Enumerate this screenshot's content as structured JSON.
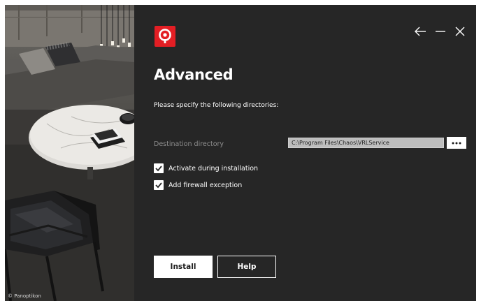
{
  "page": {
    "title": "Advanced",
    "subtitle": "Please specify the following directories:"
  },
  "photo": {
    "credit": "© Panoptikon"
  },
  "window_controls": {
    "back_icon": "arrow-left-icon",
    "minimize_icon": "minimize-icon",
    "close_icon": "close-icon"
  },
  "destination": {
    "label": "Destination directory",
    "value": "C:\\Program Files\\Chaos\\VRLService",
    "browse_icon": "ellipsis-icon"
  },
  "options": [
    {
      "label": "Activate during installation",
      "checked": true
    },
    {
      "label": "Add firewall exception",
      "checked": true
    }
  ],
  "buttons": {
    "install": "Install",
    "help": "Help"
  },
  "colors": {
    "background": "#262626",
    "brand": "#e31e24",
    "text": "#ffffff",
    "muted": "#8e8e8e"
  }
}
